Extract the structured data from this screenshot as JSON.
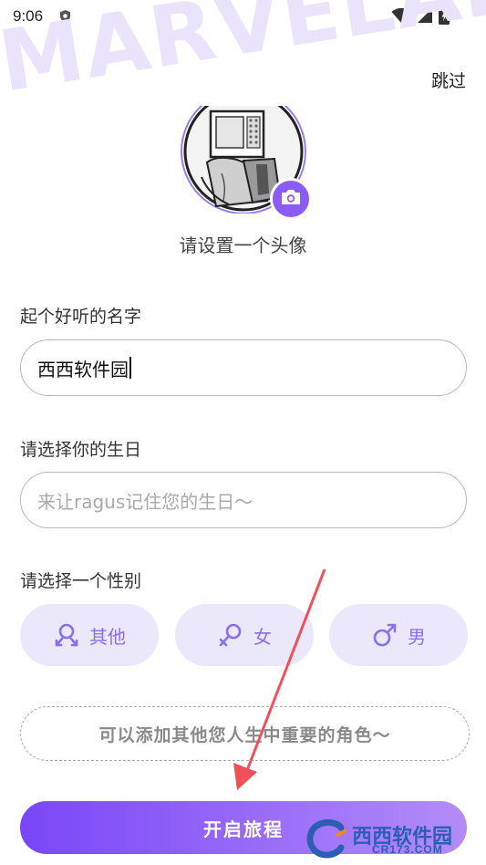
{
  "status_bar": {
    "time": "9:06"
  },
  "watermark_text": "MARVELAI",
  "header": {
    "skip_label": "跳过"
  },
  "avatar": {
    "label": "请设置一个头像",
    "camera_icon": "camera-icon"
  },
  "name_section": {
    "label": "起个好听的名字",
    "value": "西西软件园"
  },
  "birthday_section": {
    "label": "请选择你的生日",
    "placeholder": "来让ragus记住您的生日～"
  },
  "gender_section": {
    "label": "请选择一个性别",
    "options": [
      {
        "label": "其他",
        "icon": "other-gender-icon"
      },
      {
        "label": "女",
        "icon": "female-icon"
      },
      {
        "label": "男",
        "icon": "male-icon"
      }
    ]
  },
  "add_role_label": "可以添加其他您人生中重要的角色～",
  "start_button_label": "开启旅程",
  "site_logo": {
    "brand": "西西软件园",
    "domain": "CR173.COM"
  },
  "colors": {
    "accent": "#8a5cf5",
    "chip_bg": "#ece8fc",
    "annotation_arrow": "#f0505a"
  }
}
